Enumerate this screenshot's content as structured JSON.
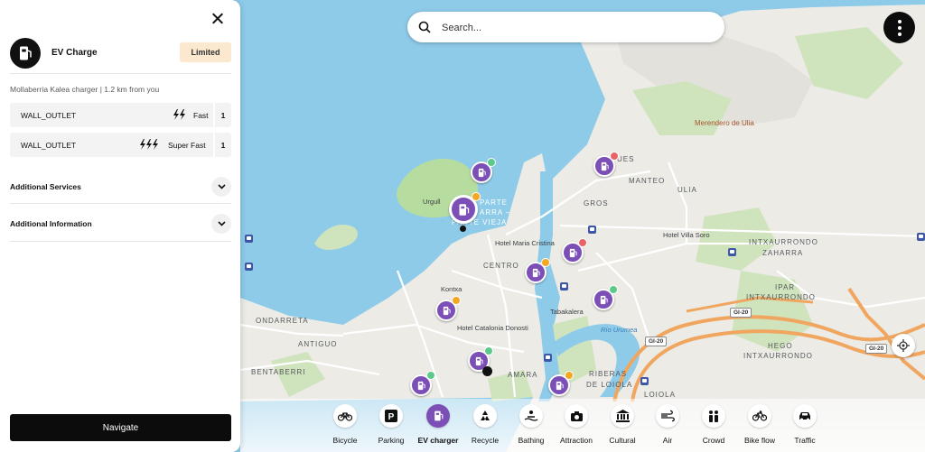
{
  "search": {
    "placeholder": "Search..."
  },
  "panel": {
    "title": "EV Charge",
    "status_badge": "Limited",
    "subtitle": "Mollaberria Kalea charger  | 1.2 km from you",
    "connectors": [
      {
        "type": "WALL_OUTLET",
        "speed": "Fast",
        "count": "1",
        "bolt_icon": "double-bolt-icon"
      },
      {
        "type": "WALL_OUTLET",
        "speed": "Super Fast",
        "count": "1",
        "bolt_icon": "triple-bolt-icon"
      }
    ],
    "sections": [
      {
        "label": "Additional Services"
      },
      {
        "label": "Additional Information"
      }
    ],
    "navigate_label": "Navigate"
  },
  "categories": [
    {
      "label": "Bicycle",
      "icon": "bicycle-icon"
    },
    {
      "label": "Parking",
      "icon": "parking-icon"
    },
    {
      "label": "EV charger",
      "icon": "ev-charger-icon",
      "active": true
    },
    {
      "label": "Recycle",
      "icon": "recycle-icon"
    },
    {
      "label": "Bathing",
      "icon": "bathing-icon"
    },
    {
      "label": "Attraction",
      "icon": "camera-icon"
    },
    {
      "label": "Cultural",
      "icon": "museum-icon"
    },
    {
      "label": "Air",
      "icon": "wind-icon"
    },
    {
      "label": "Crowd",
      "icon": "people-icon"
    },
    {
      "label": "Bike flow",
      "icon": "bike-flow-icon"
    },
    {
      "label": "Traffic",
      "icon": "car-icon"
    }
  ],
  "map": {
    "labels": {
      "merendero": "Merendero de Ulia",
      "ues": "UES",
      "manteo": "MANTEO",
      "ulia": "ULIA",
      "gros": "GROS",
      "urgull": "Urgull",
      "parte_vieja_1": "PARTE",
      "parte_vieja_2": "ARRA –",
      "parte_vieja_3": "PARTE VIEJA",
      "centro": "CENTRO",
      "hotel_maria_cristina": "Hotel Maria Cristina",
      "hotel_villa_soro": "Hotel Villa Soro",
      "intxaurrondo_zaharra_1": "INTXAURRONDO",
      "intxaurrondo_zaharra_2": "ZAHARRA",
      "ipar_1": "IPAR",
      "ipar_2": "INTXAURRONDO",
      "kontxa": "Kontxa",
      "tabakalera": "Tabakalera",
      "ondarreta": "ONDARRETA",
      "hotel_catalonia": "Hotel Catalonia Donosti",
      "rio_urumea": "Río Urumea",
      "antiguo": "ANTIGUO",
      "hego_1": "HEGO",
      "hego_2": "INTXAURRONDO",
      "bentaberri": "BENTABERRI",
      "amara": "AMARA",
      "riberas_1": "RIBERAS",
      "riberas_2": "DE LOIOLA",
      "loiola": "LOIOLA"
    },
    "road_shields": [
      "GI-20",
      "GI-20",
      "GI-20"
    ],
    "colors": {
      "water": "#8ecbe9",
      "land": "#ecebe6",
      "park": "#b7dca0",
      "charger_pin": "#7b4fb6",
      "highway": "#f0a65f"
    }
  }
}
